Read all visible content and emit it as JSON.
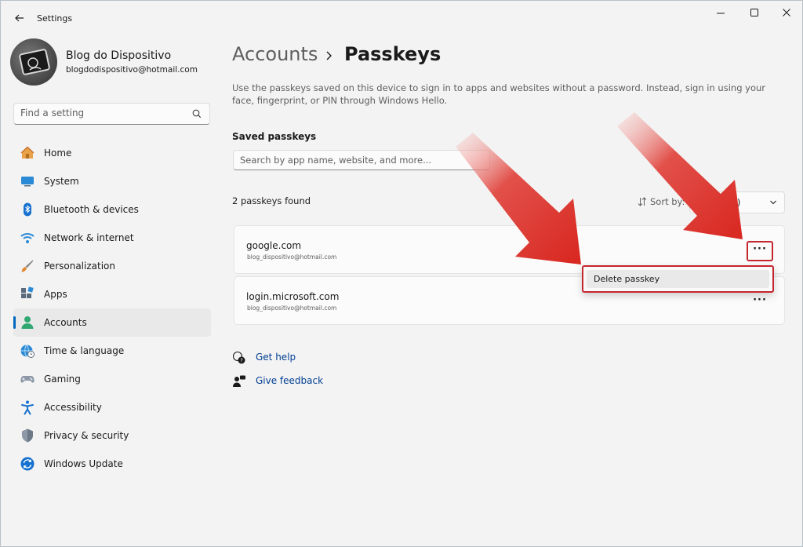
{
  "window": {
    "title": "Settings",
    "colors": {
      "accent": "#0067c0",
      "highlight_red": "#c4262e",
      "arrow_red": "#d8261f"
    }
  },
  "profile": {
    "name": "Blog do Dispositivo",
    "email": "blogdodispositivo@hotmail.com"
  },
  "sidebar": {
    "search_placeholder": "Find a setting",
    "items": [
      {
        "label": "Home",
        "icon": "home-icon",
        "active": false
      },
      {
        "label": "System",
        "icon": "system-icon",
        "active": false
      },
      {
        "label": "Bluetooth & devices",
        "icon": "bluetooth-icon",
        "active": false
      },
      {
        "label": "Network & internet",
        "icon": "wifi-icon",
        "active": false
      },
      {
        "label": "Personalization",
        "icon": "brush-icon",
        "active": false
      },
      {
        "label": "Apps",
        "icon": "apps-icon",
        "active": false
      },
      {
        "label": "Accounts",
        "icon": "accounts-icon",
        "active": true
      },
      {
        "label": "Time & language",
        "icon": "globe-clock-icon",
        "active": false
      },
      {
        "label": "Gaming",
        "icon": "gamepad-icon",
        "active": false
      },
      {
        "label": "Accessibility",
        "icon": "accessibility-icon",
        "active": false
      },
      {
        "label": "Privacy & security",
        "icon": "shield-icon",
        "active": false
      },
      {
        "label": "Windows Update",
        "icon": "update-icon",
        "active": false
      }
    ]
  },
  "main": {
    "breadcrumb": {
      "parent": "Accounts",
      "current": "Passkeys"
    },
    "description": "Use the passkeys saved on this device to sign in to apps and websites without a password. Instead, sign in using your face, fingerprint, or PIN through Windows Hello.",
    "saved_title": "Saved passkeys",
    "search_placeholder": "Search by app name, website, and more...",
    "count_text": "2 passkeys found",
    "sort": {
      "label": "Sort by:",
      "value": "e (A to Z)"
    },
    "passkeys": [
      {
        "domain": "google.com",
        "account": "blog_dispositivo@hotmail.com",
        "more": "···"
      },
      {
        "domain": "login.microsoft.com",
        "account": "blog_dispositivo@hotmail.com",
        "more": "···"
      }
    ],
    "context_menu": {
      "delete_label": "Delete passkey"
    },
    "links": {
      "help": "Get help",
      "feedback": "Give feedback"
    }
  }
}
